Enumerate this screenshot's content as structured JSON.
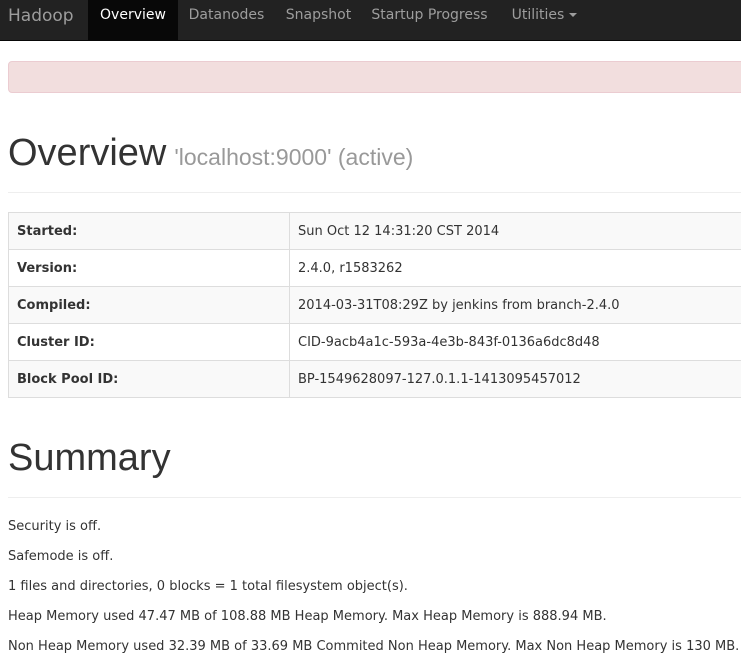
{
  "navbar": {
    "brand": "Hadoop",
    "items": [
      {
        "label": "Overview",
        "active": true
      },
      {
        "label": "Datanodes",
        "active": false
      },
      {
        "label": "Snapshot",
        "active": false
      },
      {
        "label": "Startup Progress",
        "active": false
      },
      {
        "label": "Utilities",
        "active": false,
        "dropdown": true
      }
    ]
  },
  "overview": {
    "title": "Overview",
    "subtitle": "'localhost:9000' (active)",
    "rows": [
      {
        "label": "Started:",
        "value": "Sun Oct 12 14:31:20 CST 2014"
      },
      {
        "label": "Version:",
        "value": "2.4.0, r1583262"
      },
      {
        "label": "Compiled:",
        "value": "2014-03-31T08:29Z by jenkins from branch-2.4.0"
      },
      {
        "label": "Cluster ID:",
        "value": "CID-9acb4a1c-593a-4e3b-843f-0136a6dc8d48"
      },
      {
        "label": "Block Pool ID:",
        "value": "BP-1549628097-127.0.1.1-1413095457012"
      }
    ]
  },
  "summary": {
    "title": "Summary",
    "lines": [
      "Security is off.",
      "Safemode is off.",
      "1 files and directories, 0 blocks = 1 total filesystem object(s).",
      "Heap Memory used 47.47 MB of 108.88 MB Heap Memory. Max Heap Memory is 888.94 MB.",
      "Non Heap Memory used 32.39 MB of 33.69 MB Commited Non Heap Memory. Max Non Heap Memory is 130 MB."
    ]
  },
  "colors": {
    "navbar_bg": "#222222",
    "nav_active_bg": "#080808",
    "alert_bg": "#f2dede"
  }
}
